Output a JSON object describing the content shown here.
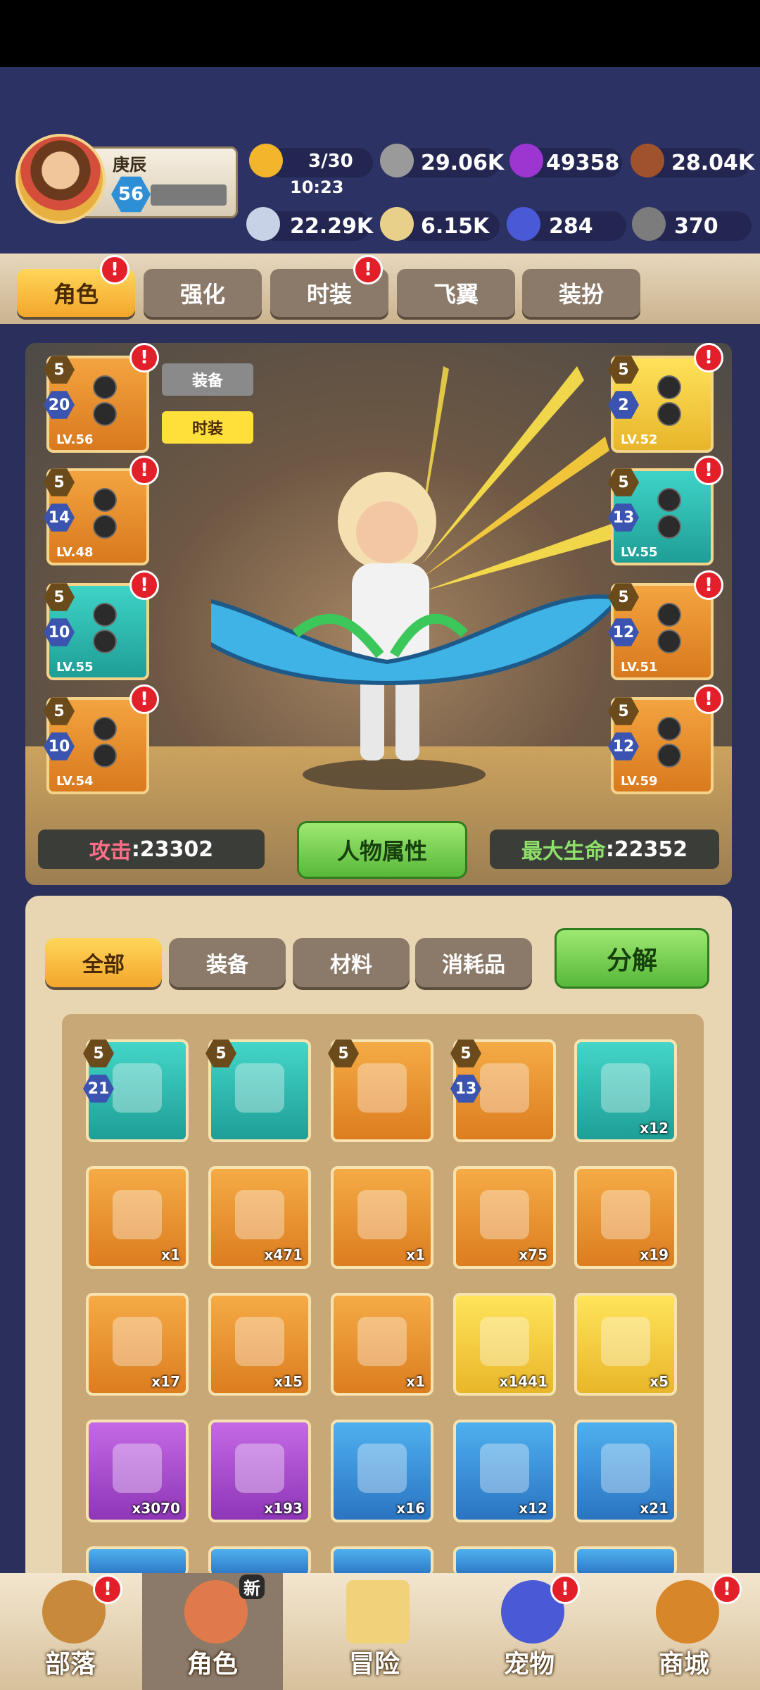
{
  "player": {
    "name": "庚辰",
    "level": "56"
  },
  "resources": {
    "stamina": {
      "value": "3/30",
      "timer": "10:23",
      "icon": "meat-icon"
    },
    "stone": {
      "value": "29.06K",
      "icon": "stone-icon"
    },
    "gem_purple": {
      "value": "49358",
      "icon": "purple-gem-icon"
    },
    "wood": {
      "value": "28.04K",
      "icon": "wood-icon"
    },
    "bone": {
      "value": "22.29K",
      "icon": "bone-icon"
    },
    "shell": {
      "value": "6.15K",
      "icon": "shell-icon"
    },
    "crystal": {
      "value": "284",
      "icon": "crystal-icon"
    },
    "ore": {
      "value": "370",
      "icon": "ore-icon"
    }
  },
  "tabs": [
    "角色",
    "强化",
    "时装",
    "飞翼",
    "装扮"
  ],
  "alert_mark": "!",
  "stage": {
    "equip_toggle": "装备",
    "fashion_toggle": "时装",
    "left_slots": [
      {
        "star": "5",
        "level": "20",
        "lv": "LV.56"
      },
      {
        "star": "5",
        "level": "14",
        "lv": "LV.48"
      },
      {
        "star": "5",
        "level": "10",
        "lv": "LV.55"
      },
      {
        "star": "5",
        "level": "10",
        "lv": "LV.54"
      }
    ],
    "right_slots": [
      {
        "star": "5",
        "level": "2",
        "lv": "LV.52"
      },
      {
        "star": "5",
        "level": "13",
        "lv": "LV.55"
      },
      {
        "star": "5",
        "level": "12",
        "lv": "LV.51"
      },
      {
        "star": "5",
        "level": "12",
        "lv": "LV.59"
      }
    ],
    "attack_label": "攻击",
    "attack_value": ":23302",
    "attr_button": "人物属性",
    "hp_label": "最大生命",
    "hp_value": ":22352"
  },
  "inventory": {
    "filters": [
      "全部",
      "装备",
      "材料",
      "消耗品"
    ],
    "decompose": "分解",
    "rows": [
      [
        {
          "color": "teal",
          "star": "5",
          "level": "21",
          "qty": ""
        },
        {
          "color": "teal",
          "star": "5",
          "level": "",
          "qty": ""
        },
        {
          "color": "orange",
          "star": "5",
          "level": "",
          "qty": ""
        },
        {
          "color": "orange",
          "star": "5",
          "level": "13",
          "qty": ""
        },
        {
          "color": "teal",
          "star": "",
          "level": "",
          "qty": "x12"
        }
      ],
      [
        {
          "color": "orange",
          "qty": "x1"
        },
        {
          "color": "orange",
          "qty": "x471"
        },
        {
          "color": "orange",
          "qty": "x1"
        },
        {
          "color": "orange",
          "qty": "x75"
        },
        {
          "color": "orange",
          "qty": "x19"
        }
      ],
      [
        {
          "color": "orange",
          "qty": "x17"
        },
        {
          "color": "orange",
          "qty": "x15"
        },
        {
          "color": "orange",
          "qty": "x1"
        },
        {
          "color": "yellow",
          "qty": "x1441"
        },
        {
          "color": "yellow",
          "qty": "x5"
        }
      ],
      [
        {
          "color": "purple",
          "qty": "x3070"
        },
        {
          "color": "purple",
          "qty": "x193"
        },
        {
          "color": "blue",
          "qty": "x16"
        },
        {
          "color": "blue",
          "qty": "x12"
        },
        {
          "color": "blue",
          "qty": "x21"
        }
      ]
    ]
  },
  "bottom_nav": [
    {
      "label": "部落",
      "icon": "tribe-icon"
    },
    {
      "label": "角色",
      "icon": "character-icon",
      "badge": "新"
    },
    {
      "label": "冒险",
      "icon": "map-icon"
    },
    {
      "label": "宠物",
      "icon": "pet-icon"
    },
    {
      "label": "商城",
      "icon": "shop-icon"
    }
  ]
}
